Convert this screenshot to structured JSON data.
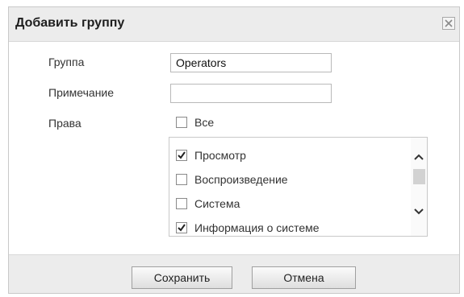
{
  "dialog": {
    "title": "Добавить группу",
    "close_icon": "close-icon"
  },
  "form": {
    "group_label": "Группа",
    "group_value": "Operators",
    "note_label": "Примечание",
    "note_value": "",
    "rights_label": "Права",
    "all_label": "Все",
    "all_checked": false
  },
  "permissions": [
    {
      "label": "Просмотр",
      "checked": true
    },
    {
      "label": "Воспроизведение",
      "checked": false
    },
    {
      "label": "Система",
      "checked": false
    },
    {
      "label": "Информация о системе",
      "checked": true
    }
  ],
  "footer": {
    "save_label": "Сохранить",
    "cancel_label": "Отмена"
  }
}
